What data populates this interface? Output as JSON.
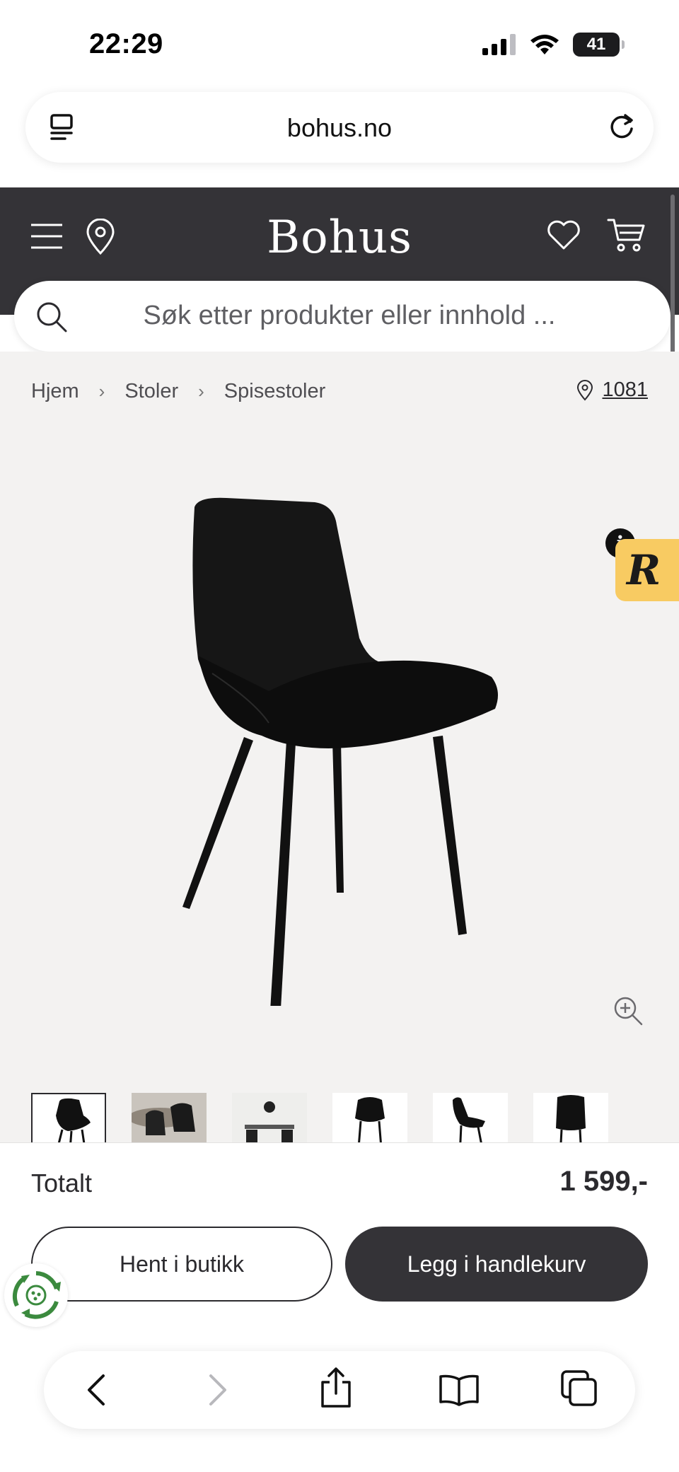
{
  "status_bar": {
    "time": "22:29",
    "battery": "41"
  },
  "browser": {
    "url": "bohus.no"
  },
  "header": {
    "logo": "Bohus"
  },
  "search": {
    "placeholder": "Søk etter produkter eller innhold ..."
  },
  "breadcrumb": {
    "items": [
      "Hjem",
      "Stoler",
      "Spisestoler"
    ],
    "store_code": "1081"
  },
  "product_badge": {
    "info_label": "i",
    "badge_letter": "R"
  },
  "purchase": {
    "total_label": "Totalt",
    "total_price": "1 599,-",
    "pickup_label": "Hent i butikk",
    "cart_label": "Legg i handlekurv"
  },
  "colors": {
    "header_bg": "#343337",
    "gallery_bg": "#f3f2f1",
    "badge_yellow": "#f8cb62",
    "eco_green": "#3b8a3e"
  }
}
